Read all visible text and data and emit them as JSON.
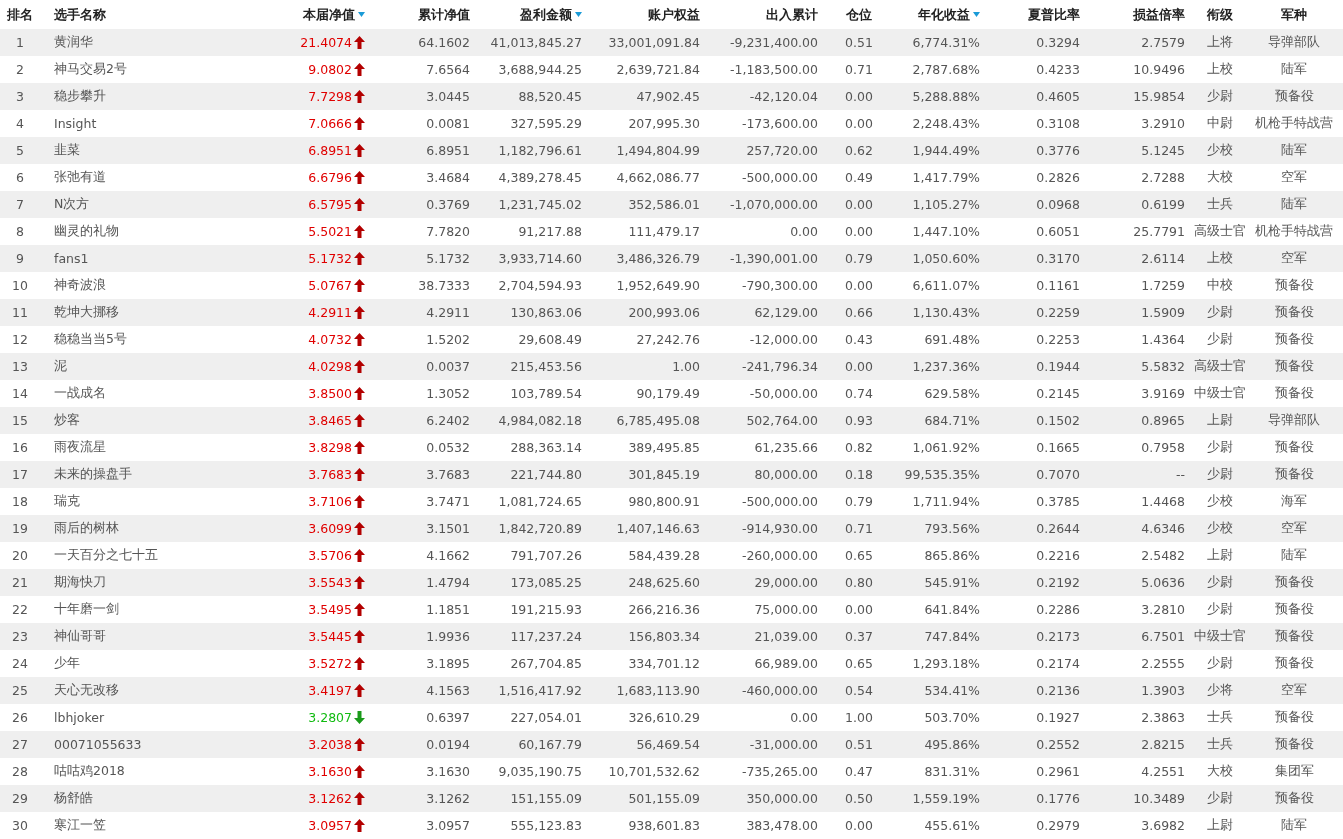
{
  "table": {
    "columns": [
      {
        "label": "排名",
        "sorted": false
      },
      {
        "label": "选手名称",
        "sorted": false
      },
      {
        "label": "本届净值",
        "sorted": true
      },
      {
        "label": "累计净值",
        "sorted": false
      },
      {
        "label": "盈利金额",
        "sorted": true
      },
      {
        "label": "账户权益",
        "sorted": false
      },
      {
        "label": "出入累计",
        "sorted": false
      },
      {
        "label": "仓位",
        "sorted": false
      },
      {
        "label": "年化收益",
        "sorted": true
      },
      {
        "label": "夏普比率",
        "sorted": false
      },
      {
        "label": "损益倍率",
        "sorted": false
      },
      {
        "label": "衔级",
        "sorted": false
      },
      {
        "label": "军种",
        "sorted": false
      }
    ],
    "rows": [
      {
        "rising": true,
        "cells": [
          "1",
          "黄润华",
          "21.4074",
          "64.1602",
          "41,013,845.27",
          "33,001,091.84",
          "-9,231,400.00",
          "0.51",
          "6,774.31%",
          "0.3294",
          "2.7579",
          "上将",
          "导弹部队"
        ]
      },
      {
        "rising": true,
        "cells": [
          "2",
          "神马交易2号",
          "9.0802",
          "7.6564",
          "3,688,944.25",
          "2,639,721.84",
          "-1,183,500.00",
          "0.71",
          "2,787.68%",
          "0.4233",
          "10.9496",
          "上校",
          "陆军"
        ]
      },
      {
        "rising": true,
        "cells": [
          "3",
          "稳步攀升",
          "7.7298",
          "3.0445",
          "88,520.45",
          "47,902.45",
          "-42,120.04",
          "0.00",
          "5,288.88%",
          "0.4605",
          "15.9854",
          "少尉",
          "预备役"
        ]
      },
      {
        "rising": true,
        "cells": [
          "4",
          "Insight",
          "7.0666",
          "0.0081",
          "327,595.29",
          "207,995.30",
          "-173,600.00",
          "0.00",
          "2,248.43%",
          "0.3108",
          "3.2910",
          "中尉",
          "机枪手特战营"
        ]
      },
      {
        "rising": true,
        "cells": [
          "5",
          "韭菜",
          "6.8951",
          "6.8951",
          "1,182,796.61",
          "1,494,804.99",
          "257,720.00",
          "0.62",
          "1,944.49%",
          "0.3776",
          "5.1245",
          "少校",
          "陆军"
        ]
      },
      {
        "rising": true,
        "cells": [
          "6",
          "张弛有道",
          "6.6796",
          "3.4684",
          "4,389,278.45",
          "4,662,086.77",
          "-500,000.00",
          "0.49",
          "1,417.79%",
          "0.2826",
          "2.7288",
          "大校",
          "空军"
        ]
      },
      {
        "rising": true,
        "cells": [
          "7",
          "N次方",
          "6.5795",
          "0.3769",
          "1,231,745.02",
          "352,586.01",
          "-1,070,000.00",
          "0.00",
          "1,105.27%",
          "0.0968",
          "0.6199",
          "士兵",
          "陆军"
        ]
      },
      {
        "rising": true,
        "cells": [
          "8",
          "幽灵的礼物",
          "5.5021",
          "7.7820",
          "91,217.88",
          "111,479.17",
          "0.00",
          "0.00",
          "1,447.10%",
          "0.6051",
          "25.7791",
          "高级士官",
          "机枪手特战营"
        ]
      },
      {
        "rising": true,
        "cells": [
          "9",
          "fans1",
          "5.1732",
          "5.1732",
          "3,933,714.60",
          "3,486,326.79",
          "-1,390,001.00",
          "0.79",
          "1,050.60%",
          "0.3170",
          "2.6114",
          "上校",
          "空军"
        ]
      },
      {
        "rising": true,
        "cells": [
          "10",
          "神奇波浪",
          "5.0767",
          "38.7333",
          "2,704,594.93",
          "1,952,649.90",
          "-790,300.00",
          "0.00",
          "6,611.07%",
          "0.1161",
          "1.7259",
          "中校",
          "预备役"
        ]
      },
      {
        "rising": true,
        "cells": [
          "11",
          "乾坤大挪移",
          "4.2911",
          "4.2911",
          "130,863.06",
          "200,993.06",
          "62,129.00",
          "0.66",
          "1,130.43%",
          "0.2259",
          "1.5909",
          "少尉",
          "预备役"
        ]
      },
      {
        "rising": true,
        "cells": [
          "12",
          "稳稳当当5号",
          "4.0732",
          "1.5202",
          "29,608.49",
          "27,242.76",
          "-12,000.00",
          "0.43",
          "691.48%",
          "0.2253",
          "1.4364",
          "少尉",
          "预备役"
        ]
      },
      {
        "rising": true,
        "cells": [
          "13",
          "泥",
          "4.0298",
          "0.0037",
          "215,453.56",
          "1.00",
          "-241,796.34",
          "0.00",
          "1,237.36%",
          "0.1944",
          "5.5832",
          "高级士官",
          "预备役"
        ]
      },
      {
        "rising": true,
        "cells": [
          "14",
          "一战成名",
          "3.8500",
          "1.3052",
          "103,789.54",
          "90,179.49",
          "-50,000.00",
          "0.74",
          "629.58%",
          "0.2145",
          "3.9169",
          "中级士官",
          "预备役"
        ]
      },
      {
        "rising": true,
        "cells": [
          "15",
          "炒客",
          "3.8465",
          "6.2402",
          "4,984,082.18",
          "6,785,495.08",
          "502,764.00",
          "0.93",
          "684.71%",
          "0.1502",
          "0.8965",
          "上尉",
          "导弹部队"
        ]
      },
      {
        "rising": true,
        "cells": [
          "16",
          "雨夜流星",
          "3.8298",
          "0.0532",
          "288,363.14",
          "389,495.85",
          "61,235.66",
          "0.82",
          "1,061.92%",
          "0.1665",
          "0.7958",
          "少尉",
          "预备役"
        ]
      },
      {
        "rising": true,
        "cells": [
          "17",
          "未来的操盘手",
          "3.7683",
          "3.7683",
          "221,744.80",
          "301,845.19",
          "80,000.00",
          "0.18",
          "99,535.35%",
          "0.7070",
          "--",
          "少尉",
          "预备役"
        ]
      },
      {
        "rising": true,
        "cells": [
          "18",
          "瑞克",
          "3.7106",
          "3.7471",
          "1,081,724.65",
          "980,800.91",
          "-500,000.00",
          "0.79",
          "1,711.94%",
          "0.3785",
          "1.4468",
          "少校",
          "海军"
        ]
      },
      {
        "rising": true,
        "cells": [
          "19",
          "雨后的树林",
          "3.6099",
          "3.1501",
          "1,842,720.89",
          "1,407,146.63",
          "-914,930.00",
          "0.71",
          "793.56%",
          "0.2644",
          "4.6346",
          "少校",
          "空军"
        ]
      },
      {
        "rising": true,
        "cells": [
          "20",
          "一天百分之七十五",
          "3.5706",
          "4.1662",
          "791,707.26",
          "584,439.28",
          "-260,000.00",
          "0.65",
          "865.86%",
          "0.2216",
          "2.5482",
          "上尉",
          "陆军"
        ]
      },
      {
        "rising": true,
        "cells": [
          "21",
          "期海快刀",
          "3.5543",
          "1.4794",
          "173,085.25",
          "248,625.60",
          "29,000.00",
          "0.80",
          "545.91%",
          "0.2192",
          "5.0636",
          "少尉",
          "预备役"
        ]
      },
      {
        "rising": true,
        "cells": [
          "22",
          "十年磨一剑",
          "3.5495",
          "1.1851",
          "191,215.93",
          "266,216.36",
          "75,000.00",
          "0.00",
          "641.84%",
          "0.2286",
          "3.2810",
          "少尉",
          "预备役"
        ]
      },
      {
        "rising": true,
        "cells": [
          "23",
          "神仙哥哥",
          "3.5445",
          "1.9936",
          "117,237.24",
          "156,803.34",
          "21,039.00",
          "0.37",
          "747.84%",
          "0.2173",
          "6.7501",
          "中级士官",
          "预备役"
        ]
      },
      {
        "rising": true,
        "cells": [
          "24",
          "少年",
          "3.5272",
          "3.1895",
          "267,704.85",
          "334,701.12",
          "66,989.00",
          "0.65",
          "1,293.18%",
          "0.2174",
          "2.2555",
          "少尉",
          "预备役"
        ]
      },
      {
        "rising": true,
        "cells": [
          "25",
          "天心无改移",
          "3.4197",
          "4.1563",
          "1,516,417.92",
          "1,683,113.90",
          "-460,000.00",
          "0.54",
          "534.41%",
          "0.2136",
          "1.3903",
          "少将",
          "空军"
        ]
      },
      {
        "rising": false,
        "cells": [
          "26",
          "lbhjoker",
          "3.2807",
          "0.6397",
          "227,054.01",
          "326,610.29",
          "0.00",
          "1.00",
          "503.70%",
          "0.1927",
          "2.3863",
          "士兵",
          "预备役"
        ]
      },
      {
        "rising": true,
        "cells": [
          "27",
          "00071055633",
          "3.2038",
          "0.0194",
          "60,167.79",
          "56,469.54",
          "-31,000.00",
          "0.51",
          "495.86%",
          "0.2552",
          "2.8215",
          "士兵",
          "预备役"
        ]
      },
      {
        "rising": true,
        "cells": [
          "28",
          "咕咕鸡2018",
          "3.1630",
          "3.1630",
          "9,035,190.75",
          "10,701,532.62",
          "-735,265.00",
          "0.47",
          "831.31%",
          "0.2961",
          "4.2551",
          "大校",
          "集团军"
        ]
      },
      {
        "rising": true,
        "cells": [
          "29",
          "杨舒皓",
          "3.1262",
          "3.1262",
          "151,155.09",
          "501,155.09",
          "350,000.00",
          "0.50",
          "1,559.19%",
          "0.1776",
          "10.3489",
          "少尉",
          "预备役"
        ]
      },
      {
        "rising": true,
        "cells": [
          "30",
          "寒江一笠",
          "3.0957",
          "3.0957",
          "555,123.83",
          "938,601.83",
          "383,478.00",
          "0.00",
          "455.61%",
          "0.2979",
          "3.6982",
          "上尉",
          "陆军"
        ]
      }
    ]
  }
}
